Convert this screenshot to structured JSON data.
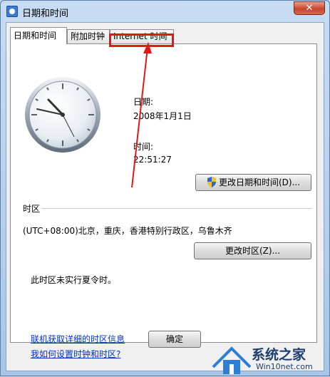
{
  "window": {
    "title": "日期和时间",
    "close_label": "✕"
  },
  "tabs": [
    {
      "label": "日期和时间",
      "active": true
    },
    {
      "label": "附加时钟",
      "active": false
    },
    {
      "label": "Internet 时间",
      "active": false
    }
  ],
  "datetime": {
    "date_label": "日期:",
    "date_value": "2008年1月1日",
    "time_label": "时间:",
    "time_value": "22:51:27",
    "change_button": "更改日期和时间(D)..."
  },
  "timezone": {
    "section_label": "时区",
    "value": "(UTC+08:00)北京，重庆，香港特别行政区，乌鲁木齐",
    "change_button": "更改时区(Z)...",
    "dst_note": "此时区未实行夏令时。"
  },
  "links": {
    "online_info": "联机获取详细的时区信息",
    "how_to_set": "我如何设置时钟和时区?"
  },
  "footer": {
    "ok_label": "确定"
  },
  "watermark": {
    "brand": "系统之家",
    "site": "Win10net.com"
  },
  "colors": {
    "highlight": "#e01818",
    "link": "#0033cc"
  }
}
